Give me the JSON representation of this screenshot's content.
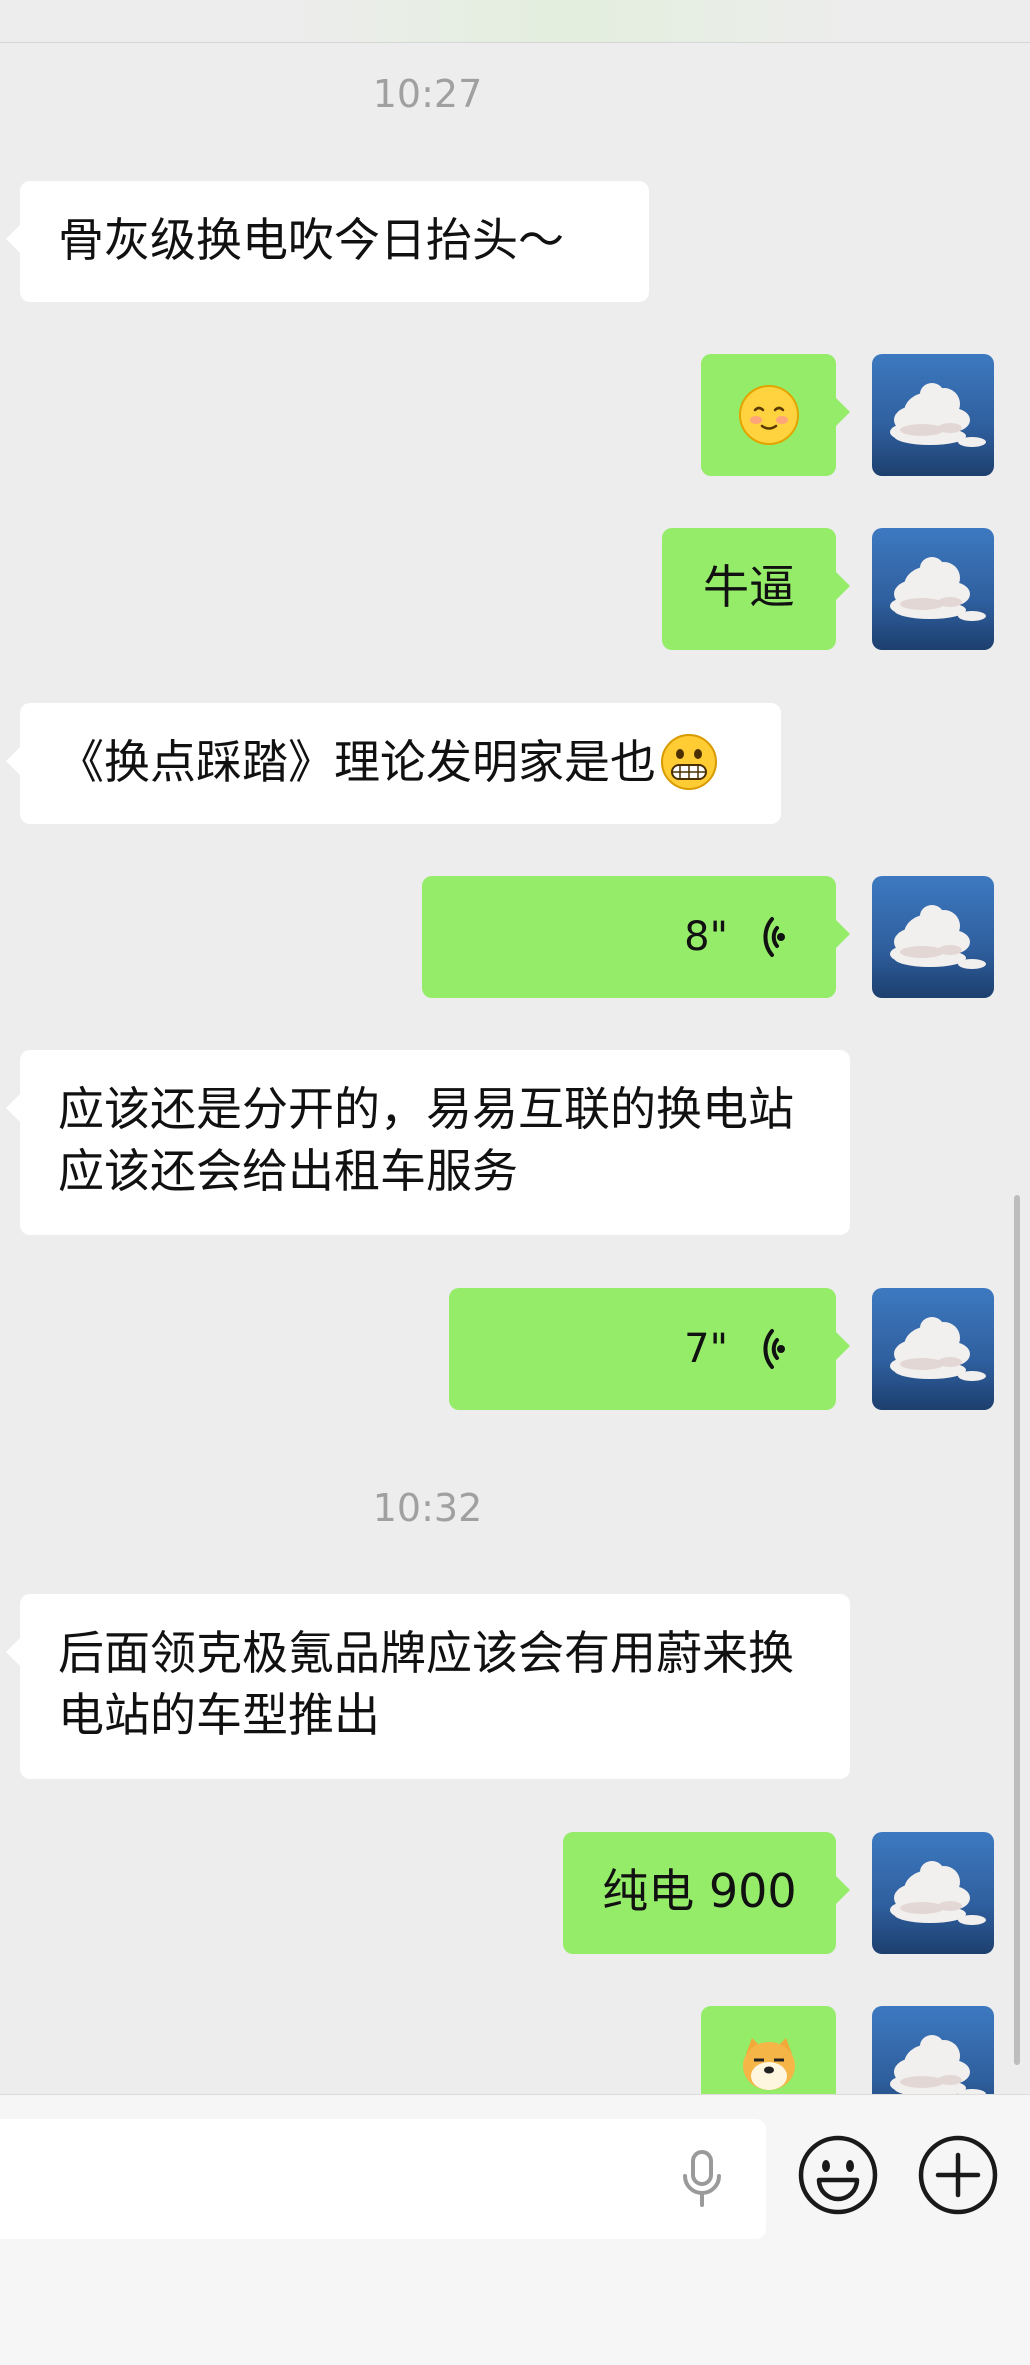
{
  "chat": {
    "timestamp_1": "10:27",
    "timestamp_2": "10:32",
    "messages": [
      {
        "text": "骨灰级换电吹今日抬头～"
      },
      {
        "text": "牛逼"
      },
      {
        "text": "《换点踩踏》理论发明家是也"
      },
      {
        "duration": "8\""
      },
      {
        "text": "应该还是分开的，易易互联的换电站应该还会给出租车服务"
      },
      {
        "duration": "7\""
      },
      {
        "text": "后面领克极氪品牌应该会有用蔚来换电站的车型推出"
      },
      {
        "text": "纯电 900"
      }
    ]
  },
  "colors": {
    "background": "#ededed",
    "incoming_bubble": "#ffffff",
    "outgoing_bubble": "#95ec69",
    "timestamp": "#a0a0a0"
  },
  "icons": {
    "avatar": "cloud-sky-avatar",
    "voice": "voice-wave-icon",
    "mic": "microphone-icon",
    "emoji": "emoji-smile-icon",
    "add": "plus-circle-icon"
  }
}
